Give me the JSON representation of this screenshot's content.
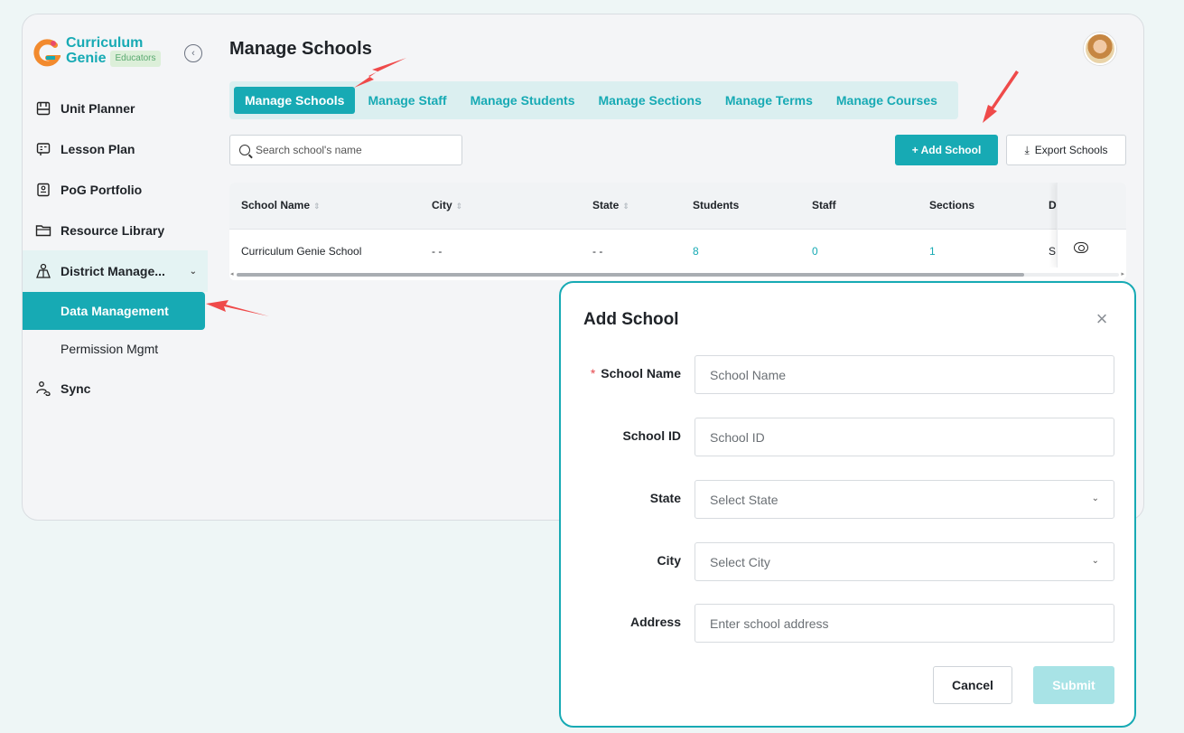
{
  "brand": {
    "line1": "Curriculum",
    "line2": "Genie",
    "badge": "Educators"
  },
  "sidebar": {
    "collapse_icon": "chevron-left-circle-icon",
    "items": [
      {
        "label": "Unit Planner",
        "icon": "planner-icon"
      },
      {
        "label": "Lesson Plan",
        "icon": "lesson-icon"
      },
      {
        "label": "PoG Portfolio",
        "icon": "portfolio-icon"
      },
      {
        "label": "Resource Library",
        "icon": "folder-icon"
      },
      {
        "label": "District Manage...",
        "icon": "district-icon"
      }
    ],
    "sub_items": [
      {
        "label": "Data Management",
        "active": true
      },
      {
        "label": "Permission Mgmt",
        "active": false
      }
    ],
    "sync": {
      "label": "Sync",
      "icon": "sync-icon"
    }
  },
  "header": {
    "title": "Manage Schools"
  },
  "tabs": [
    "Manage Schools",
    "Manage Staff",
    "Manage Students",
    "Manage Sections",
    "Manage Terms",
    "Manage Courses"
  ],
  "toolbar": {
    "search_placeholder": "Search school's name",
    "add_label": "+ Add School",
    "export_label": "Export Schools"
  },
  "table": {
    "columns": [
      "School Name",
      "City",
      "State",
      "Students",
      "Staff",
      "Sections",
      "D"
    ],
    "rows": [
      {
        "name": "Curriculum Genie School",
        "city": "- -",
        "state": "- -",
        "students": "8",
        "staff": "0",
        "sections": "1",
        "d": "S"
      }
    ]
  },
  "modal": {
    "title": "Add School",
    "fields": {
      "school_name": {
        "label": "School Name",
        "placeholder": "School Name",
        "required": true
      },
      "school_id": {
        "label": "School ID",
        "placeholder": "School ID"
      },
      "state": {
        "label": "State",
        "placeholder": "Select State"
      },
      "city": {
        "label": "City",
        "placeholder": "Select City"
      },
      "address": {
        "label": "Address",
        "placeholder": "Enter school address"
      }
    },
    "cancel_label": "Cancel",
    "submit_label": "Submit"
  },
  "colors": {
    "accent": "#17aab4",
    "annotation": "#ef4a4a"
  }
}
